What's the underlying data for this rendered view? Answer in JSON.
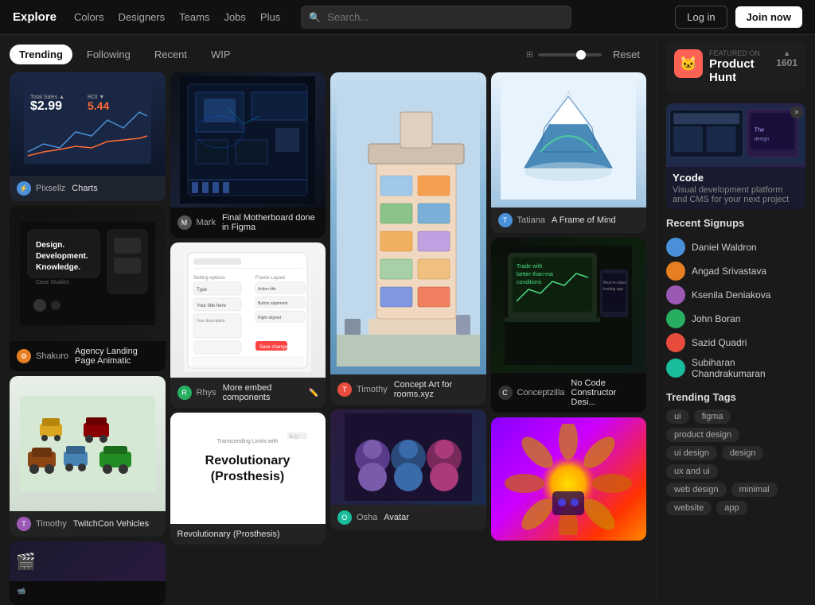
{
  "nav": {
    "logo": "Explore",
    "links": [
      "Colors",
      "Designers",
      "Teams",
      "Jobs",
      "Plus"
    ],
    "search_placeholder": "Search...",
    "login_label": "Log in",
    "join_label": "Join now"
  },
  "tabs": {
    "items": [
      "Trending",
      "Following",
      "Recent",
      "WIP"
    ],
    "active": "Trending",
    "reset_label": "Reset"
  },
  "cards": [
    {
      "author": "Pixsellz",
      "title": "Charts",
      "type": "chart"
    },
    {
      "author": "Mark",
      "title": "Final Motherboard done in Figma",
      "type": "motherboard"
    },
    {
      "author": "Timothy",
      "title": "Concept Art for rooms.xyz",
      "type": "building"
    },
    {
      "author": "Tatiana",
      "title": "A Frame of Mind",
      "type": "mountain"
    },
    {
      "author": "Shakuro",
      "title": "Agency Landing Page Animatic",
      "type": "dark-design"
    },
    {
      "author": "Rhys",
      "title": "More embed components",
      "type": "ui-mockup"
    },
    {
      "author": "Osha",
      "title": "Avatar",
      "type": "avatars"
    },
    {
      "author": "Conceptzilla",
      "title": "No Code Constructor Desi...",
      "type": "trading"
    },
    {
      "author": "Timothy",
      "title": "TwitchCon Vehicles",
      "type": "vehicles"
    },
    {
      "author": "",
      "title": "Revolutionary (Prosthesis)",
      "type": "prosthesis"
    },
    {
      "author": "",
      "title": "",
      "type": "purple"
    }
  ],
  "sidebar": {
    "featured_label": "FEATURED ON",
    "featured_title": "Product Hunt",
    "featured_count": "1601",
    "ycode_title": "Ycode",
    "ycode_desc": "Visual development platform and CMS for your next project",
    "recent_signups_title": "Recent Signups",
    "signups": [
      {
        "name": "Daniel Waldron",
        "color": "#4a90d9"
      },
      {
        "name": "Angad Srivastava",
        "color": "#e67e22"
      },
      {
        "name": "Ksenila Deniakova",
        "color": "#9b59b6"
      },
      {
        "name": "John Boran",
        "color": "#27ae60"
      },
      {
        "name": "Sazid Quadri",
        "color": "#e74c3c"
      },
      {
        "name": "Subiharan Chandrakumaran",
        "color": "#1abc9c"
      }
    ],
    "trending_tags_title": "Trending Tags",
    "tags": [
      "ui",
      "figma",
      "product design",
      "ui design",
      "design",
      "ux and ui",
      "web design",
      "minimal",
      "website",
      "app"
    ]
  }
}
